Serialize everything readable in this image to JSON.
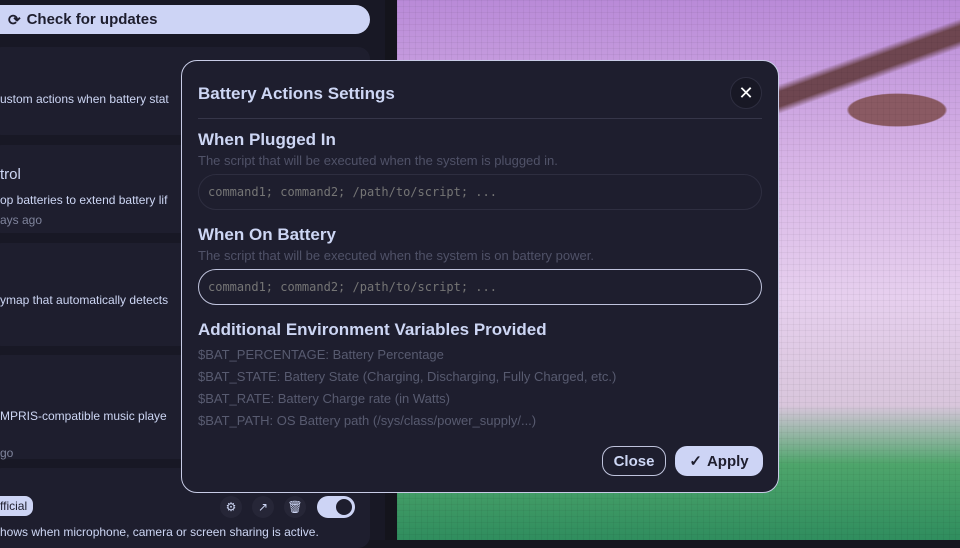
{
  "sidebar": {
    "check_updates": "Check for updates",
    "cards": [
      {
        "desc": "ustom actions when battery stat"
      },
      {
        "title": "trol",
        "desc": "op batteries to extend battery lif",
        "meta": "ays ago"
      },
      {
        "desc": "ymap that automatically detects"
      },
      {
        "desc": " MPRIS-compatible music playe",
        "meta": "go"
      },
      {
        "badge": "fficial",
        "desc": "hows when microphone, camera or screen sharing is active."
      }
    ]
  },
  "modal": {
    "title": "Battery Actions Settings",
    "plugged": {
      "heading": "When Plugged In",
      "desc": "The script that will be executed when the system is plugged in.",
      "placeholder": "command1; command2; /path/to/script; ...",
      "value": ""
    },
    "battery": {
      "heading": "When On Battery",
      "desc": "The script that will be executed when the system is on battery power.",
      "placeholder": "command1; command2; /path/to/script; ...",
      "value": ""
    },
    "env": {
      "heading": "Additional Environment Variables Provided",
      "vars": [
        "$BAT_PERCENTAGE: Battery Percentage",
        "$BAT_STATE: Battery State (Charging, Discharging, Fully Charged, etc.)",
        "$BAT_RATE: Battery Charge rate (in Watts)",
        "$BAT_PATH: OS Battery path (/sys/class/power_supply/...)"
      ]
    },
    "close_label": "Close",
    "apply_label": "Apply"
  }
}
